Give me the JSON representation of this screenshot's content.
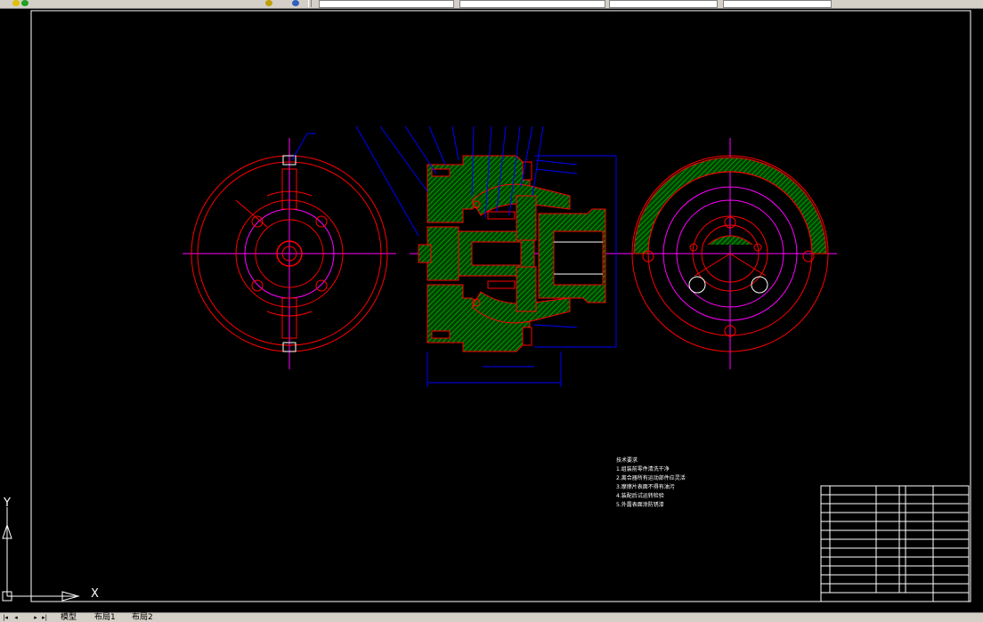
{
  "tabs": {
    "model": "模型",
    "layout1": "布局1",
    "layout2": "布局2"
  },
  "nav": {
    "first": "|◂",
    "prev": "◂",
    "next": "▸",
    "last": "▸|"
  },
  "ucs": {
    "x_label": "X",
    "y_label": "Y"
  },
  "notes": {
    "title": "技术要求",
    "lines": [
      "1.组装前零件清洗干净",
      "2.离合器所有运动部件应灵活",
      "3.摩擦片表面不得有油污",
      "4.装配后试运转检验",
      "5.外露表面涂防锈漆"
    ]
  },
  "colors": {
    "background": "#000000",
    "outline": "#ff0000",
    "center_line": "#ff00ff",
    "dimension": "#0000ff",
    "hatch": "#00c000",
    "frame": "#ffffff",
    "leader": "#0000ff"
  },
  "icons": [
    "refresh-icon",
    "layer-icon",
    "ucs-icon"
  ]
}
